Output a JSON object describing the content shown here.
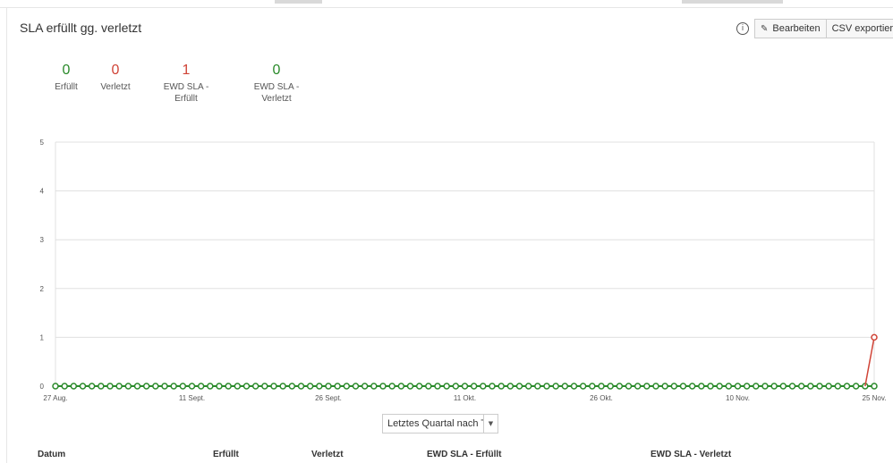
{
  "header": {
    "title": "SLA erfüllt gg. verletzt",
    "info_icon": "info-icon",
    "edit_label": "Bearbeiten",
    "edit_icon": "pencil-icon",
    "export_label": "CSV exportieren"
  },
  "stats": [
    {
      "value": "0",
      "label": "Erfüllt",
      "color": "#2a8a2a"
    },
    {
      "value": "0",
      "label": "Verletzt",
      "color": "#d04437"
    },
    {
      "value": "1",
      "label": "EWD SLA - Erfüllt",
      "color": "#d04437"
    },
    {
      "value": "0",
      "label": "EWD SLA - Verletzt",
      "color": "#2a8a2a"
    }
  ],
  "chart_data": {
    "type": "line",
    "x_ticks": [
      "27 Aug.",
      "11 Sept.",
      "26 Sept.",
      "11 Okt.",
      "26 Okt.",
      "10 Nov.",
      "25 Nov."
    ],
    "y_ticks": [
      "0",
      "1",
      "2",
      "3",
      "4",
      "5"
    ],
    "ylim": [
      0,
      5
    ],
    "x_start": "27 Aug.",
    "x_end": "25 Nov.",
    "grid": true,
    "series": [
      {
        "color": "#2a8a2a",
        "constant_value": 0,
        "num_points": 91
      },
      {
        "color": "#d04437",
        "values": [
          0,
          1
        ]
      }
    ]
  },
  "range_select": {
    "selected": "Letztes Quartal nach Tag"
  },
  "table": {
    "headers": [
      "Datum",
      "Erfüllt",
      "Verletzt",
      "EWD SLA - Erfüllt",
      "EWD SLA - Verletzt"
    ]
  }
}
